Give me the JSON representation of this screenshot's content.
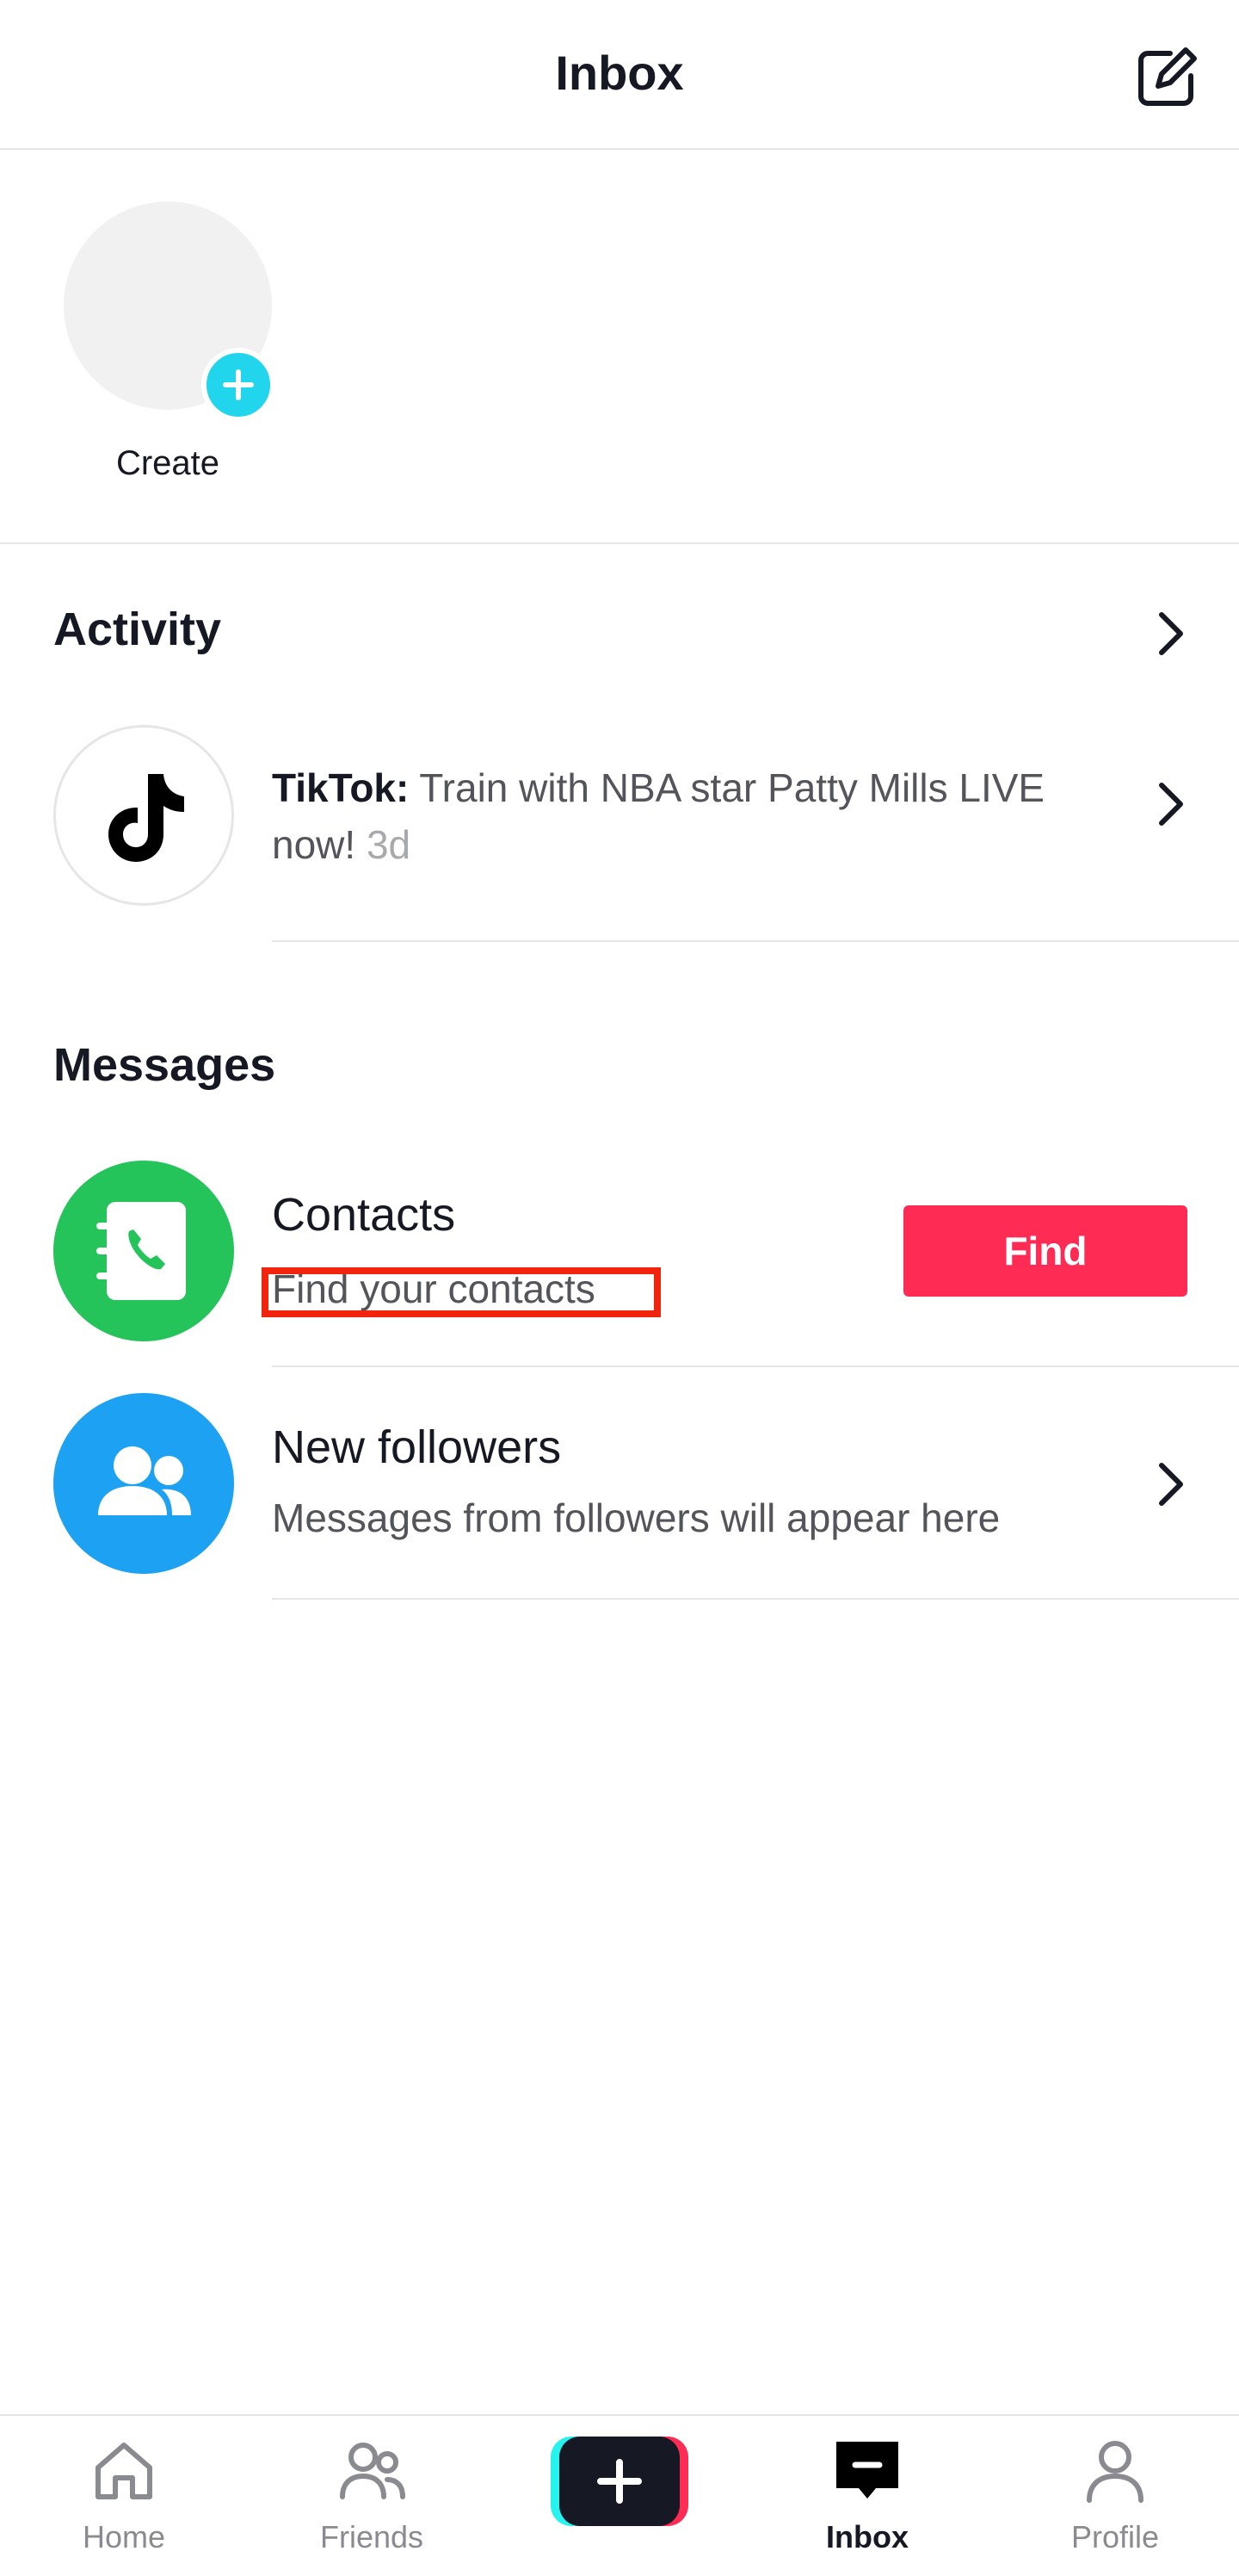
{
  "header": {
    "title": "Inbox",
    "compose_icon": "compose-icon"
  },
  "stories": {
    "create_label": "Create",
    "plus_icon": "plus-icon"
  },
  "activity": {
    "section_title": "Activity",
    "item": {
      "sender": "TikTok:",
      "message": " Train with NBA star Patty Mills LIVE now!",
      "time": " 3d",
      "icon": "tiktok-logo-icon"
    }
  },
  "messages": {
    "section_title": "Messages",
    "contacts": {
      "title": "Contacts",
      "subtitle": "Find your contacts",
      "button_label": "Find",
      "icon": "contacts-book-icon",
      "icon_color": "#25c45a"
    },
    "followers": {
      "title": "New followers",
      "subtitle": "Messages from followers will appear here",
      "icon": "followers-icon",
      "icon_color": "#1da1f2"
    }
  },
  "colors": {
    "accent": "#fe2c55",
    "highlight": "#f2240d",
    "story_plus": "#20d5ec"
  },
  "bottom_nav": {
    "items": [
      {
        "label": "Home",
        "icon": "home-icon",
        "active": false
      },
      {
        "label": "Friends",
        "icon": "friends-icon",
        "active": false
      },
      {
        "label": "",
        "icon": "create-plus-icon",
        "active": false
      },
      {
        "label": "Inbox",
        "icon": "inbox-icon",
        "active": true
      },
      {
        "label": "Profile",
        "icon": "profile-icon",
        "active": false
      }
    ]
  }
}
